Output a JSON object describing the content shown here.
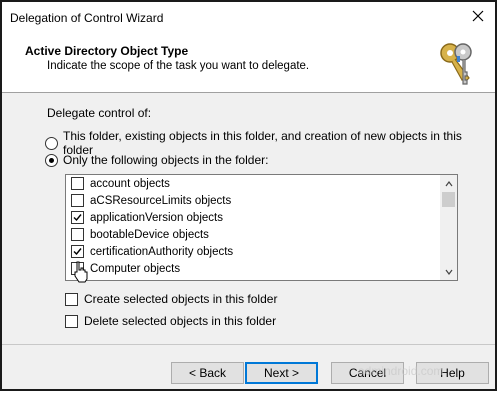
{
  "window": {
    "title": "Delegation of Control Wizard"
  },
  "header": {
    "title": "Active Directory Object Type",
    "subtitle": "Indicate the scope of the task you want to delegate."
  },
  "body": {
    "delegate_label": "Delegate control of:",
    "radio_options": [
      {
        "label": "This folder, existing objects in this folder, and creation of new objects in this folder",
        "selected": false
      },
      {
        "label": "Only the following objects in the folder:",
        "selected": true
      }
    ],
    "object_list": [
      {
        "label": "account objects",
        "checked": false
      },
      {
        "label": "aCSResourceLimits objects",
        "checked": false
      },
      {
        "label": "applicationVersion objects",
        "checked": true
      },
      {
        "label": "bootableDevice objects",
        "checked": false
      },
      {
        "label": "certificationAuthority objects",
        "checked": true
      },
      {
        "label": "Computer objects",
        "checked": false
      }
    ],
    "create_checkbox": {
      "label": "Create selected objects in this folder",
      "checked": false
    },
    "delete_checkbox": {
      "label": "Delete selected objects in this folder",
      "checked": false
    }
  },
  "footer": {
    "back_label": "< Back",
    "next_label": "Next >",
    "cancel_label": "Cancel",
    "help_label": "Help",
    "watermark": "admindroid.com"
  },
  "colors": {
    "primary_border": "#0078d7",
    "dialog_bg": "#f0f0f0"
  },
  "icons": {
    "header_icon": "keys-icon",
    "close": "close-icon"
  }
}
